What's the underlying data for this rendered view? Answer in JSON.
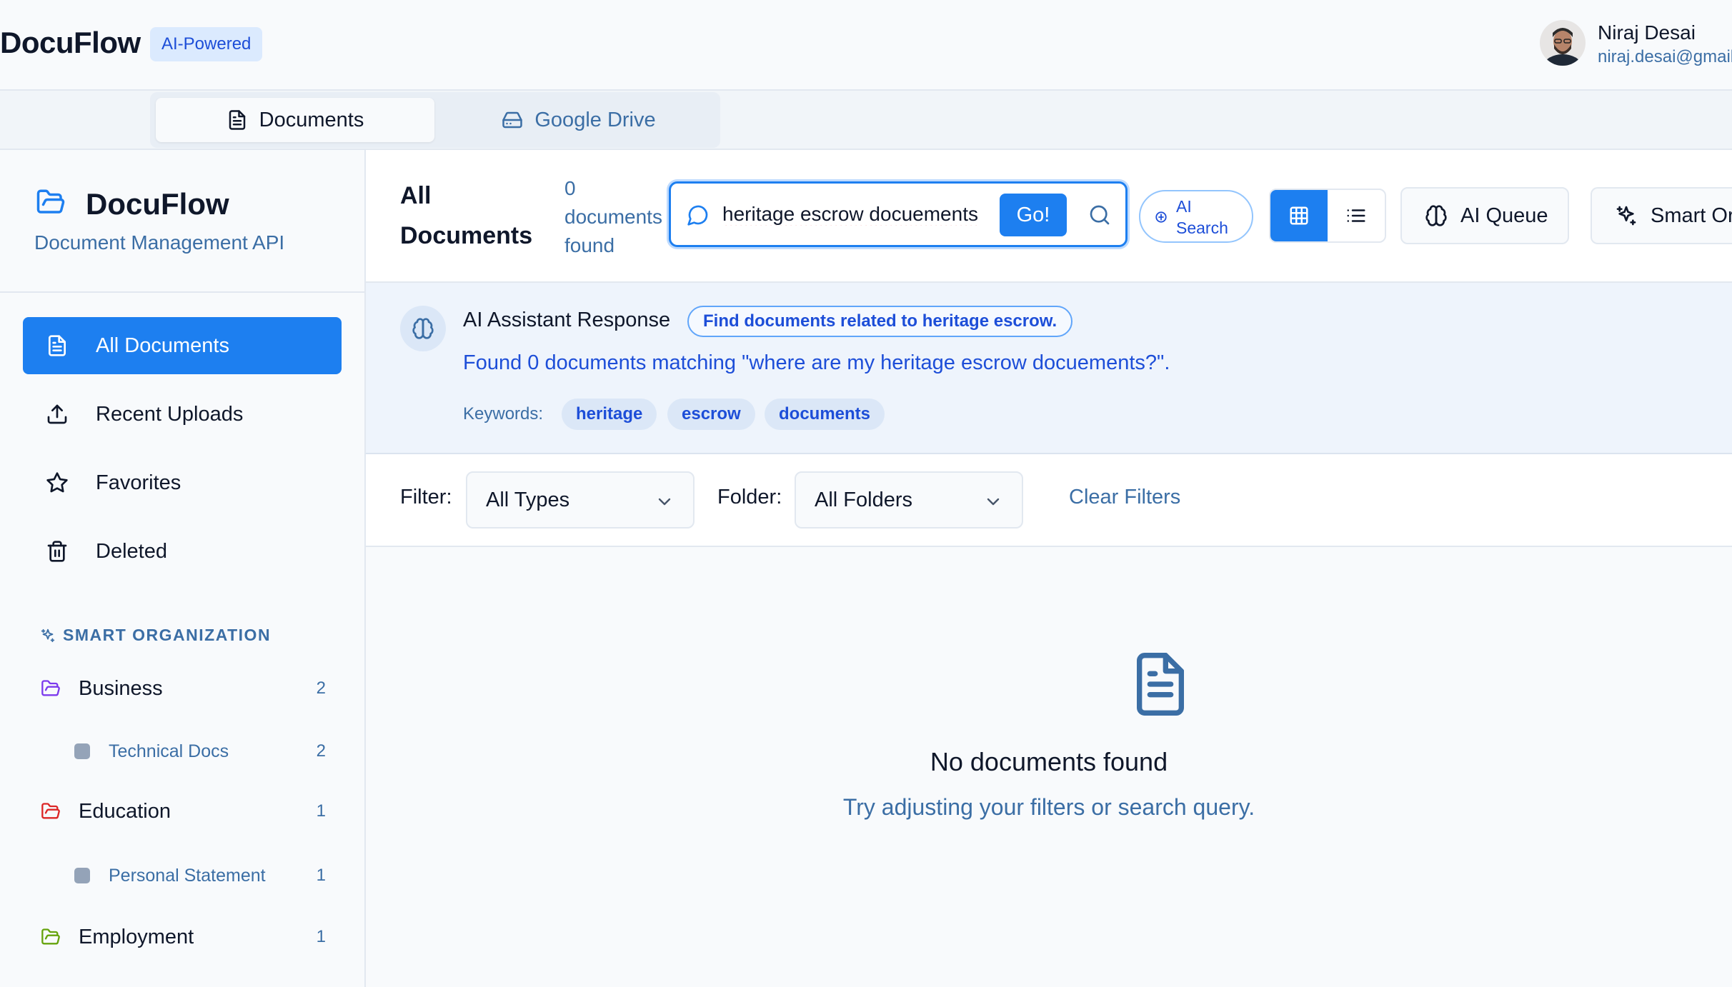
{
  "header": {
    "brand": "DocuFlow",
    "badge": "AI-Powered",
    "user_name": "Niraj Desai",
    "user_email": "niraj.desai@gmail.com"
  },
  "tabs": [
    {
      "label": "Documents",
      "icon": "document-icon",
      "active": true
    },
    {
      "label": "Google Drive",
      "icon": "drive-icon",
      "active": false
    }
  ],
  "sidebar": {
    "title": "DocuFlow",
    "subtitle": "Document Management API",
    "nav": [
      {
        "label": "All Documents",
        "icon": "document-icon",
        "active": true
      },
      {
        "label": "Recent Uploads",
        "icon": "upload-icon",
        "active": false
      },
      {
        "label": "Favorites",
        "icon": "star-icon",
        "active": false
      },
      {
        "label": "Deleted",
        "icon": "trash-icon",
        "active": false
      }
    ],
    "section_label": "SMART ORGANIZATION",
    "folders": [
      {
        "label": "Business",
        "count": "2",
        "color": "#7c3aed",
        "children": [
          {
            "label": "Technical Docs",
            "count": "2"
          }
        ]
      },
      {
        "label": "Education",
        "count": "1",
        "color": "#dc2626",
        "children": [
          {
            "label": "Personal Statement",
            "count": "1"
          }
        ]
      },
      {
        "label": "Employment",
        "count": "1",
        "color": "#65a30d",
        "children": []
      }
    ]
  },
  "main": {
    "title": "All Documents",
    "count_text": "0 documents found",
    "search": {
      "value": "heritage escrow docuements",
      "go_label": "Go!"
    },
    "ai_search_label": "AI Search",
    "ai_queue_label": "AI Queue",
    "smart_org_label": "Smart Organize"
  },
  "ai_response": {
    "title": "AI Assistant Response",
    "query_pill": "Find documents related to heritage escrow.",
    "message": "Found 0 documents matching \"where are my heritage escrow docuements?\".",
    "keywords_label": "Keywords:",
    "keywords": [
      "heritage",
      "escrow",
      "documents"
    ]
  },
  "filters": {
    "filter_label": "Filter:",
    "type_value": "All Types",
    "folder_label": "Folder:",
    "folder_value": "All Folders",
    "clear_label": "Clear Filters"
  },
  "empty_state": {
    "title": "No documents found",
    "subtitle": "Try adjusting your filters or search query."
  },
  "colors": {
    "accent": "#1d7ff0",
    "link": "#3b6ea5",
    "ai_panel_bg": "#eef4fc"
  }
}
